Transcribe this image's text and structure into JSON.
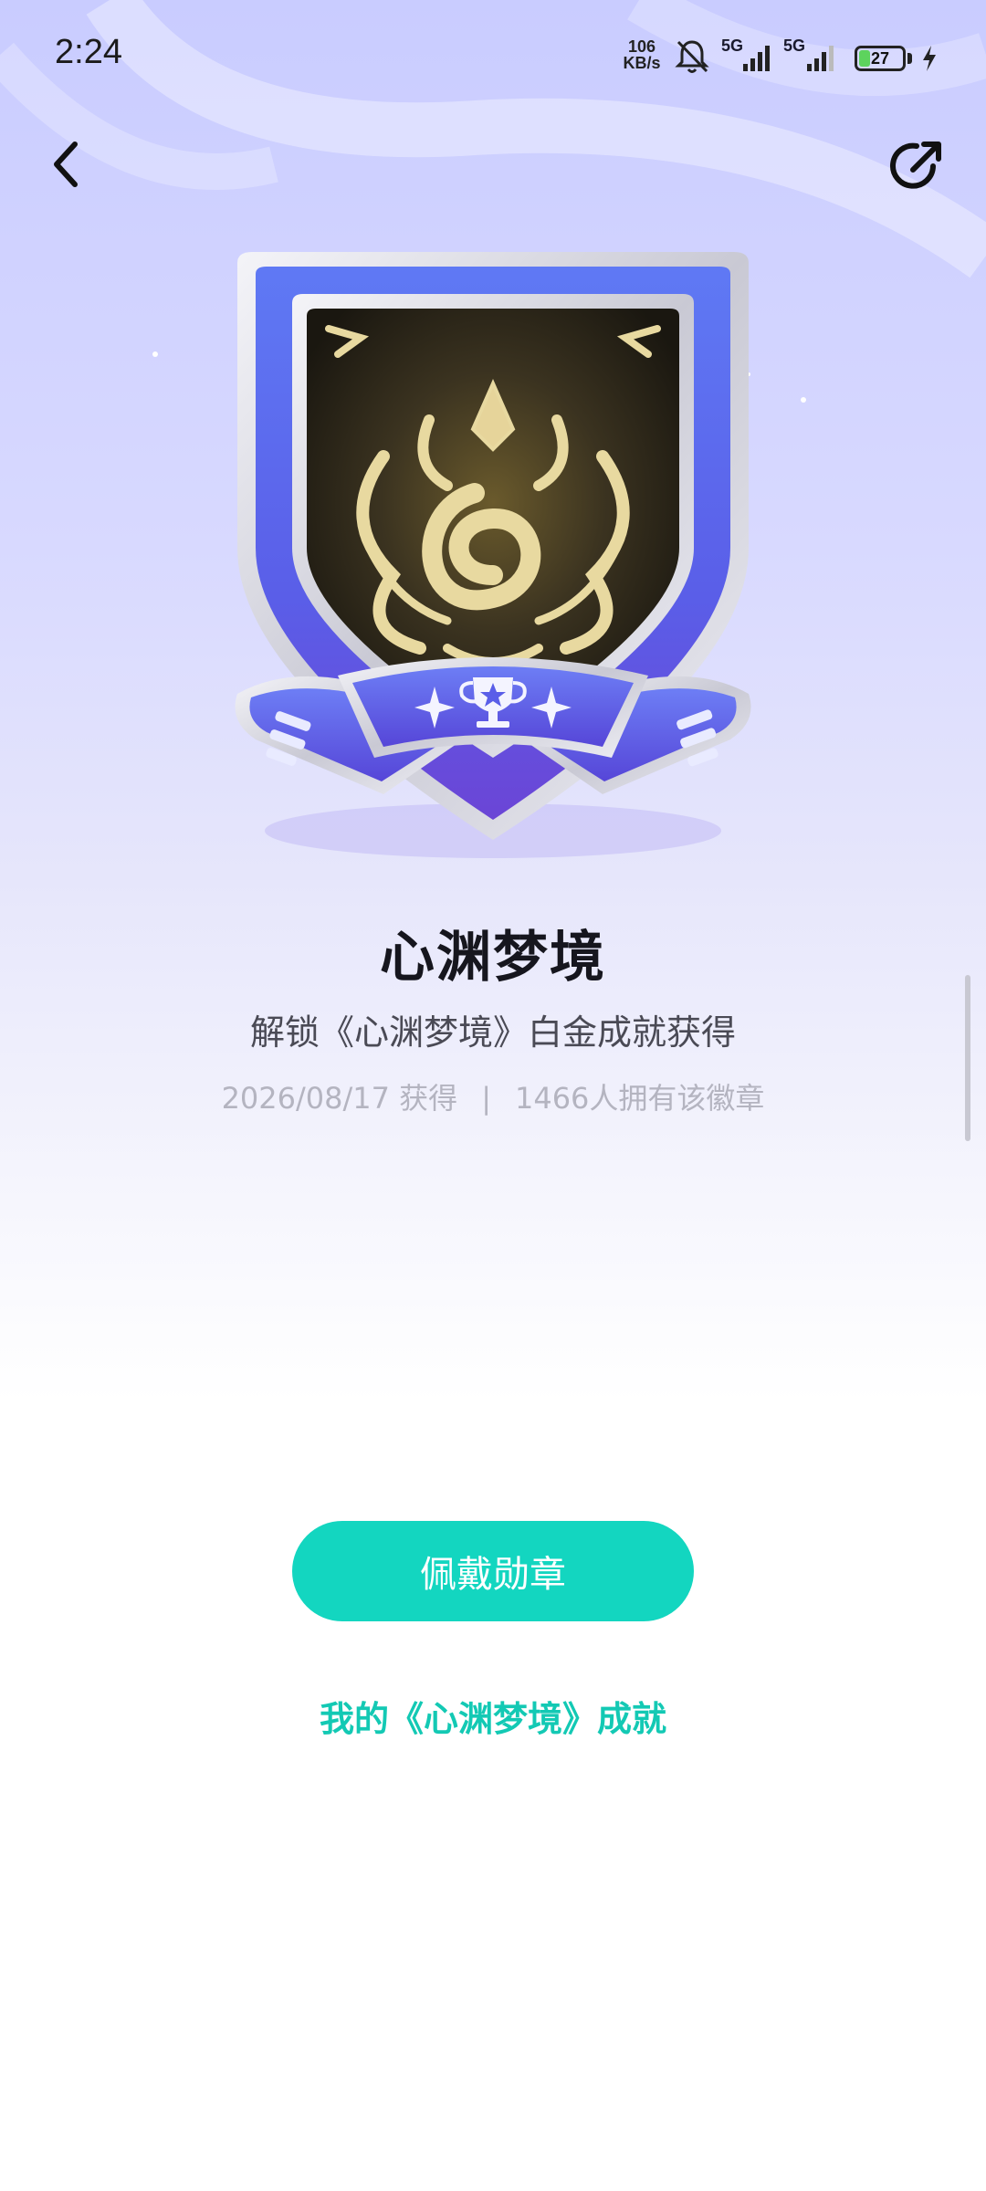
{
  "status_bar": {
    "time": "2:24",
    "net_speed_value": "106",
    "net_speed_unit": "KB/s",
    "signal_1_label": "5G",
    "signal_2_label": "5G",
    "battery_level": "27",
    "battery_percent": 27
  },
  "nav": {
    "back_icon": "chevron-left-icon",
    "share_icon": "share-icon"
  },
  "badge": {
    "name": "心渊梦境",
    "description": "解锁《心渊梦境》白金成就获得",
    "obtained_date": "2026/08/17 获得",
    "separator": "|",
    "owner_count": "1466人拥有该徽章",
    "emblem_icon": "trophy-icon"
  },
  "actions": {
    "wear_label": "佩戴勋章",
    "achievement_link": "我的《心渊梦境》成就"
  },
  "colors": {
    "accent": "#13d6c0",
    "link": "#13c9b4",
    "badge_blue": "#5b6cf0",
    "badge_purple": "#6a4fe0"
  }
}
